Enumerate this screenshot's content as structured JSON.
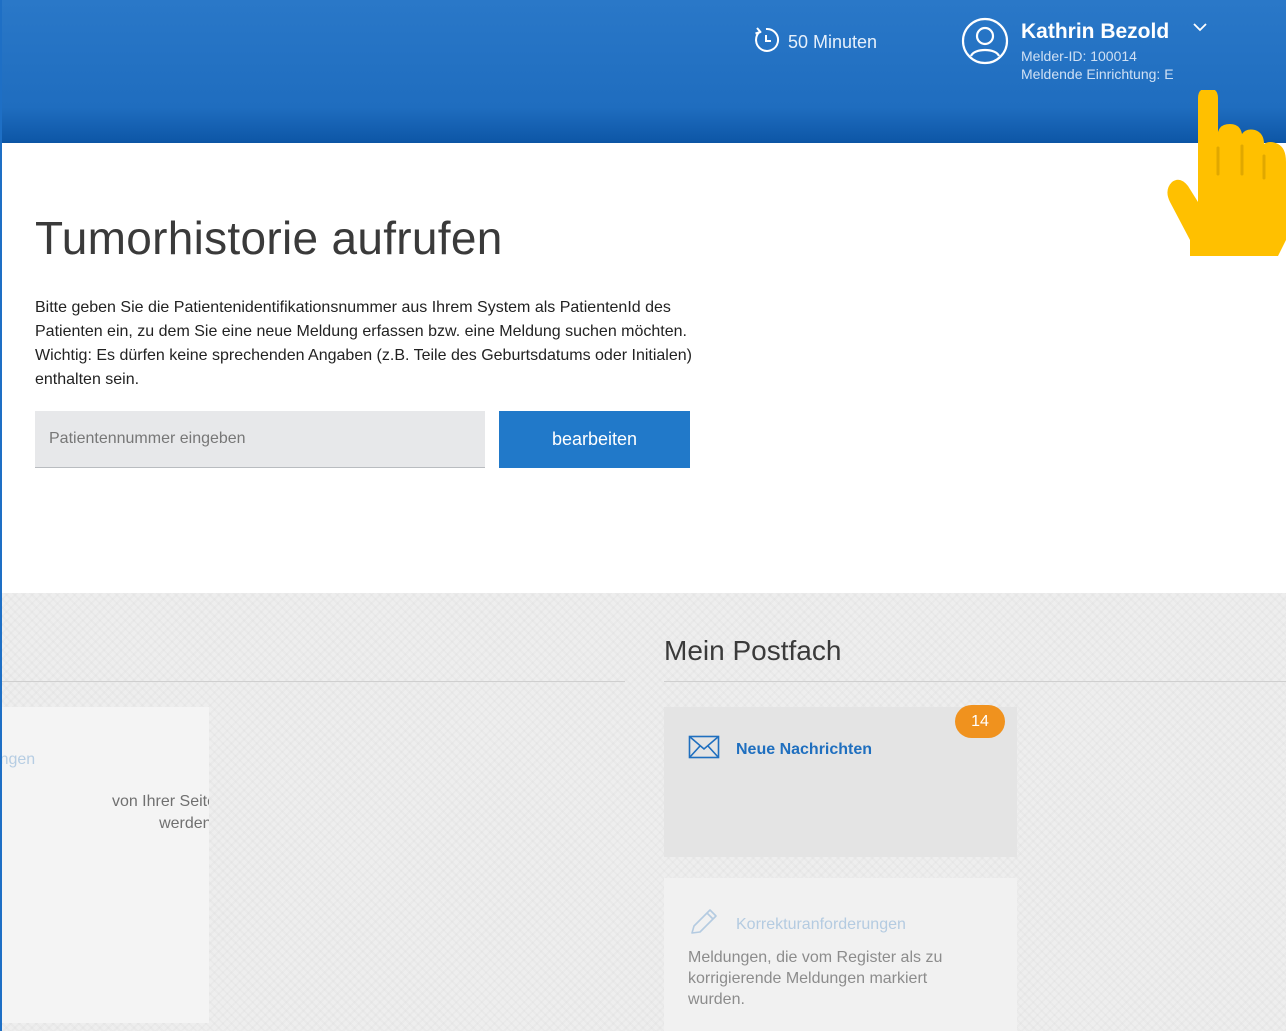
{
  "header": {
    "session_timer": "50 Minuten",
    "user": {
      "name": "Kathrin Bezold",
      "melder_id": "Melder-ID: 100014",
      "institution": "Meldende Einrichtung: E"
    }
  },
  "search": {
    "title": "Tumorhistorie aufrufen",
    "description": "Bitte geben Sie die Patientenidentifikationsnummer aus Ihrem System als PatientenId des Patienten ein, zu dem Sie eine neue Meldung erfassen bzw. eine Meldung suchen möchten. Wichtig: Es dürfen keine sprechenden Angaben (z.B. Teile des Geburtsdatums oder Initialen) enthalten sein.",
    "input_placeholder": "Patientennummer eingeben",
    "input_value": "",
    "submit_label": "bearbeiten"
  },
  "left_panel": {
    "tile_title": "Meldungen",
    "tile_desc_lines": [
      "von Ihrer Seite",
      "werden."
    ]
  },
  "postfach": {
    "title": "Mein Postfach",
    "messages": {
      "label": "Neue Nachrichten",
      "count": "14"
    },
    "corrections": {
      "label": "Korrekturanforderungen",
      "description": "Meldungen, die vom Register als zu korrigierende Meldungen markiert wurden."
    }
  },
  "colors": {
    "header_blue": "#1f6dbf",
    "button_blue": "#2179c9",
    "badge_orange": "#f0921e",
    "pointer_yellow": "#ffc000"
  },
  "icons": [
    "timer-icon",
    "user-circle-icon",
    "chevron-down-icon",
    "envelope-icon",
    "pencil-icon",
    "hand-pointer-icon"
  ]
}
